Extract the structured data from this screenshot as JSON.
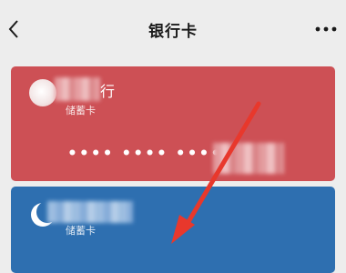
{
  "header": {
    "title": "银行卡",
    "back_icon": "chevron-left-icon",
    "more_icon": "more-dots-icon"
  },
  "cards": [
    {
      "bank_name_visible": "行",
      "card_type": "储蓄卡",
      "masked_number": "•••• •••• ••••",
      "color": "#cd5055"
    },
    {
      "card_type": "储蓄卡",
      "color": "#2e6fb0"
    }
  ],
  "annotation": {
    "color": "#e8382c"
  }
}
